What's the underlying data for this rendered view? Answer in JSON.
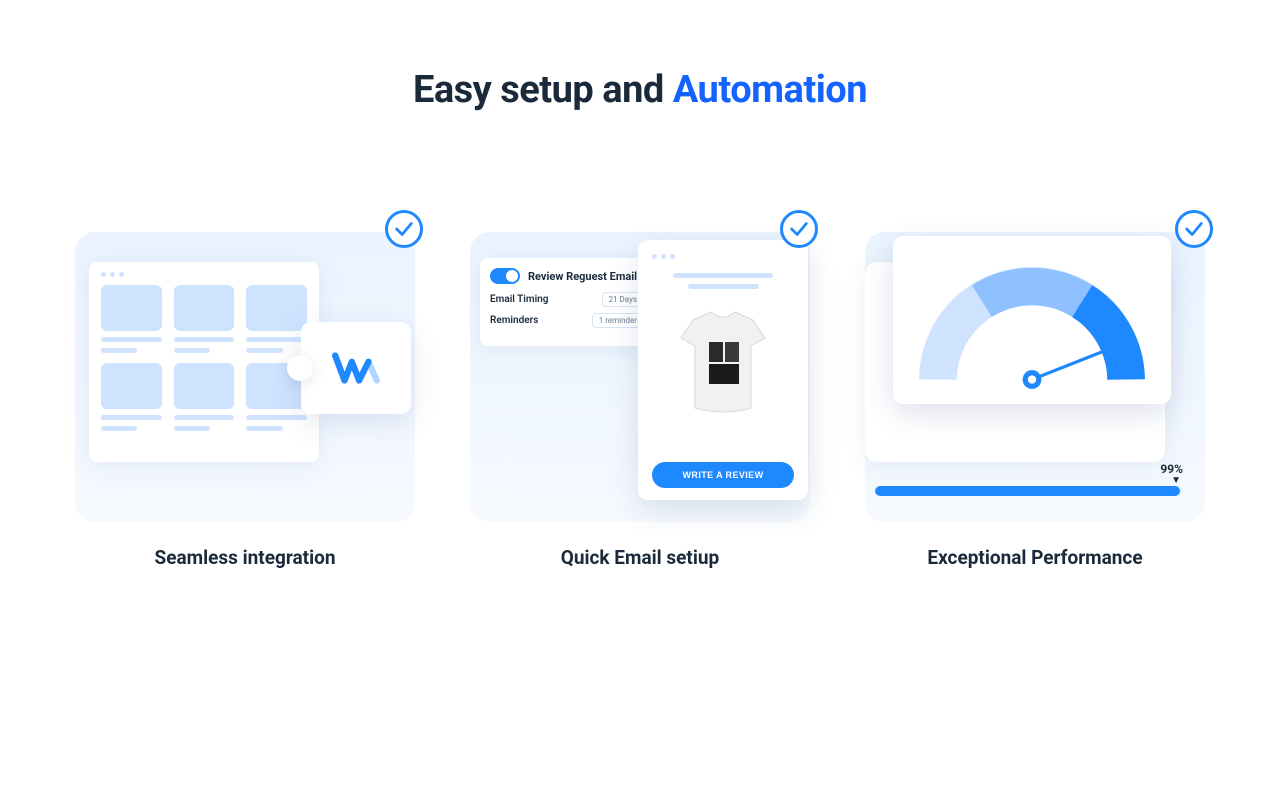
{
  "headline": {
    "black": "Easy setup and ",
    "accent": "Automation"
  },
  "cards": [
    {
      "caption": "Seamless integration"
    },
    {
      "caption": "Quick Email setiup",
      "settings": {
        "toggle_label": "Review Reguest Email",
        "timing_label": "Email Timing",
        "timing_value": "21 Days",
        "reminders_label": "Reminders",
        "reminders_value": "1 reminder"
      },
      "email": {
        "cta": "WRITE A REVIEW"
      }
    },
    {
      "caption": "Exceptional Performance",
      "gauge": {
        "value_pct": 99,
        "label": "99%"
      }
    }
  ],
  "colors": {
    "accent": "#1463ff",
    "primary": "#1e88ff"
  }
}
